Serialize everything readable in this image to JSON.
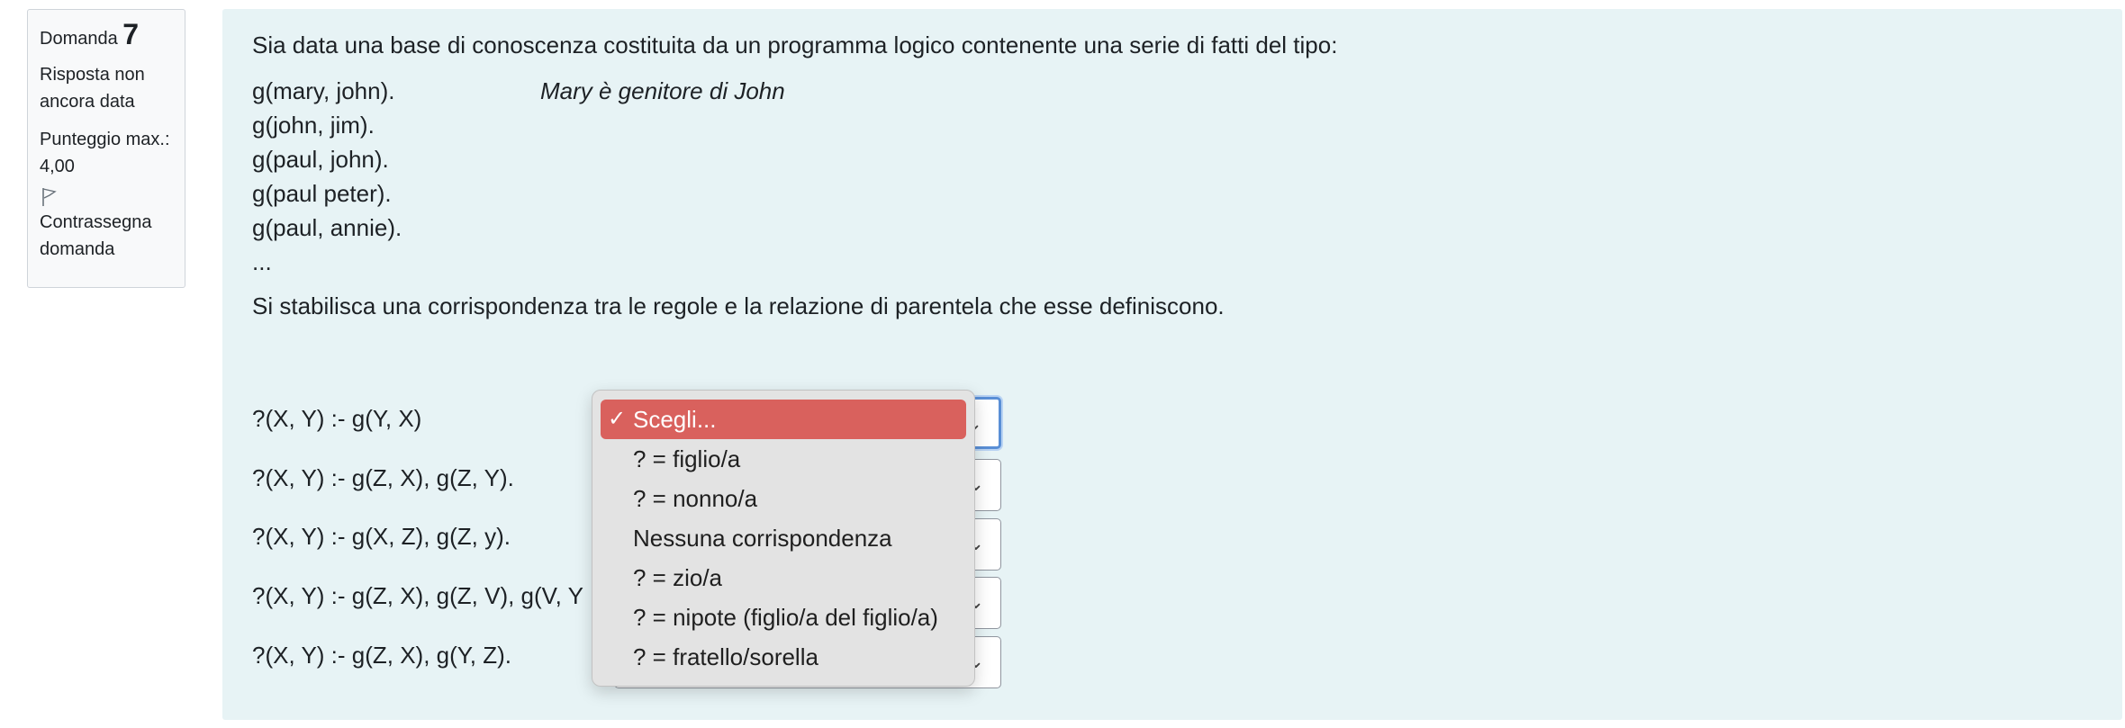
{
  "info": {
    "question_label": "Domanda",
    "question_number": "7",
    "state": "Risposta non ancora data",
    "grade": "Punteggio max.: 4,00",
    "flag_label": "Contrassegna domanda"
  },
  "question": {
    "intro": "Sia data una base di conoscenza costituita da un programma logico contenente una serie di fatti del tipo:",
    "facts": [
      {
        "code": "g(mary, john).",
        "comment": "Mary è genitore di John"
      },
      {
        "code": "g(john, jim).",
        "comment": ""
      },
      {
        "code": "g(paul, john).",
        "comment": ""
      },
      {
        "code": "g(paul peter).",
        "comment": ""
      },
      {
        "code": "g(paul, annie).",
        "comment": ""
      },
      {
        "code": "...",
        "comment": ""
      }
    ],
    "instruction": "Si stabilisca una corrispondenza tra le regole e la relazione di parentela che esse definiscono."
  },
  "rules": [
    "?(X, Y) :- g(Y, X)",
    "?(X, Y) :- g(Z, X), g(Z, Y).",
    "?(X, Y) :- g(X, Z), g(Z, y).",
    "?(X, Y) :- g(Z, X), g(Z, V), g(V, Y",
    "?(X, Y) :- g(Z, X), g(Y, Z)."
  ],
  "dropdown": {
    "options": [
      "Scegli...",
      "? = figlio/a",
      "? = nonno/a",
      "Nessuna corrispondenza",
      "? = zio/a",
      "? = nipote (figlio/a del figlio/a)",
      "? = fratello/sorella"
    ],
    "selected_index": 0,
    "check_mark": "✓",
    "highlight_color": "#d9615d"
  },
  "icons": {
    "flag": "flag-outline-icon",
    "caret": "chevron-icon"
  }
}
